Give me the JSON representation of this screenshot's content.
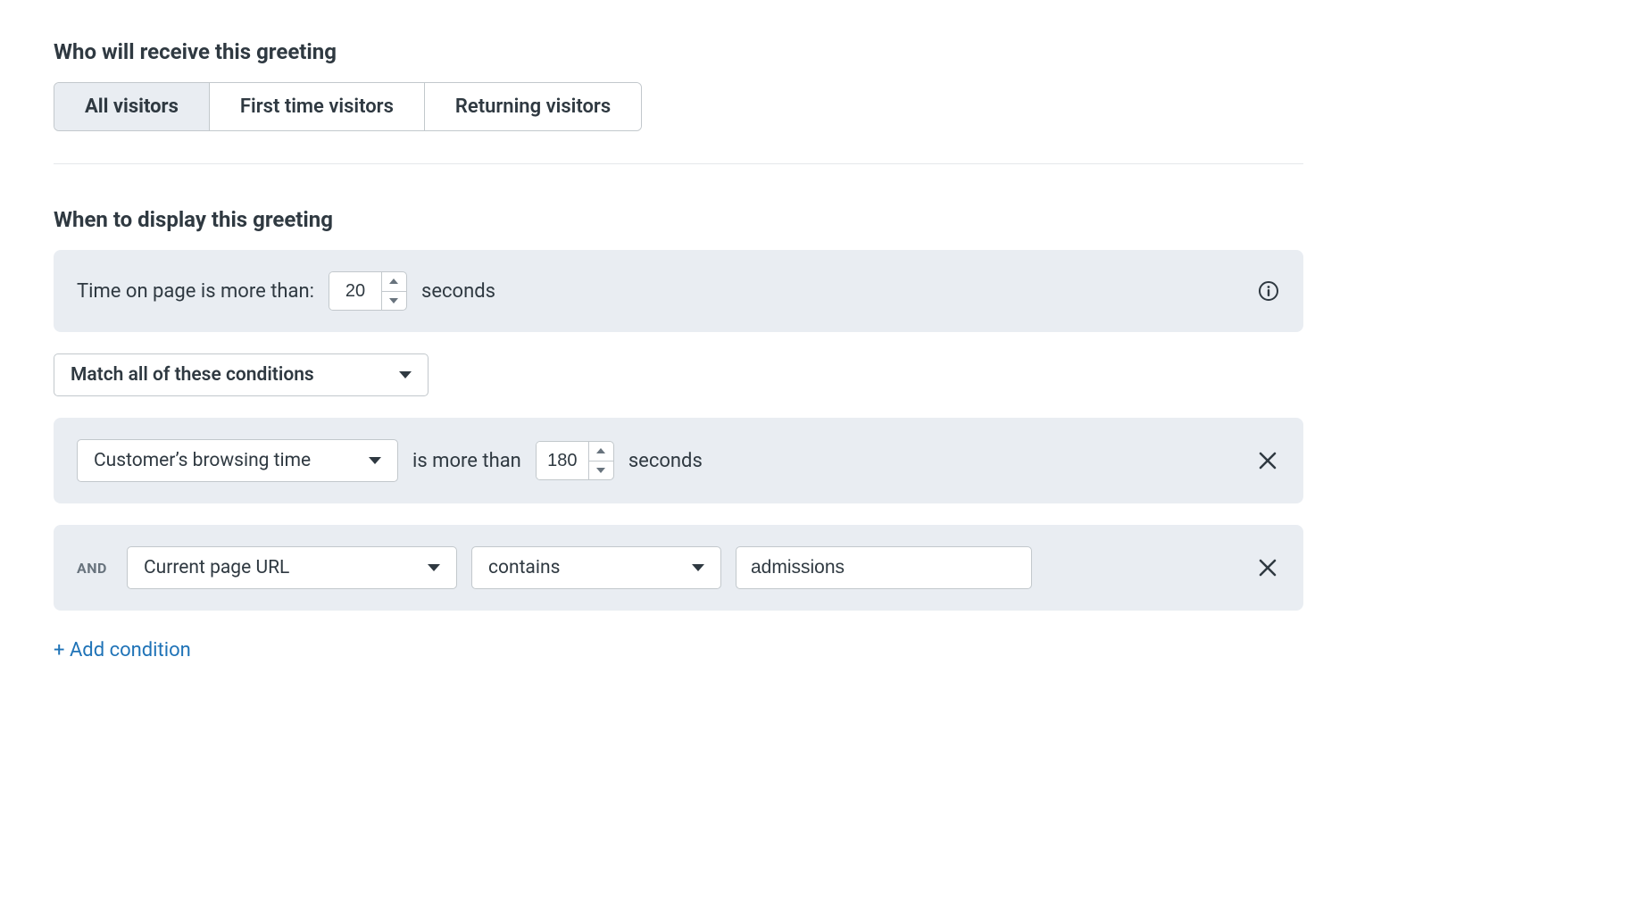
{
  "section_who": {
    "heading": "Who will receive this greeting",
    "tabs": [
      {
        "label": "All visitors",
        "active": true
      },
      {
        "label": "First time visitors",
        "active": false
      },
      {
        "label": "Returning visitors",
        "active": false
      }
    ]
  },
  "section_when": {
    "heading": "When to display this greeting",
    "time_on_page": {
      "label_prefix": "Time on page is more than:",
      "value": "20",
      "label_suffix": "seconds"
    },
    "match_mode": {
      "selected": "Match all of these conditions"
    },
    "conditions": [
      {
        "and_label": "",
        "field": "Customer’s browsing time",
        "mid_text": "is more than",
        "number_value": "180",
        "suffix": "seconds",
        "has_number": true
      },
      {
        "and_label": "AND",
        "field": "Current page URL",
        "operator": "contains",
        "text_value": "admissions",
        "has_number": false
      }
    ],
    "add_condition_label": "+ Add condition"
  }
}
